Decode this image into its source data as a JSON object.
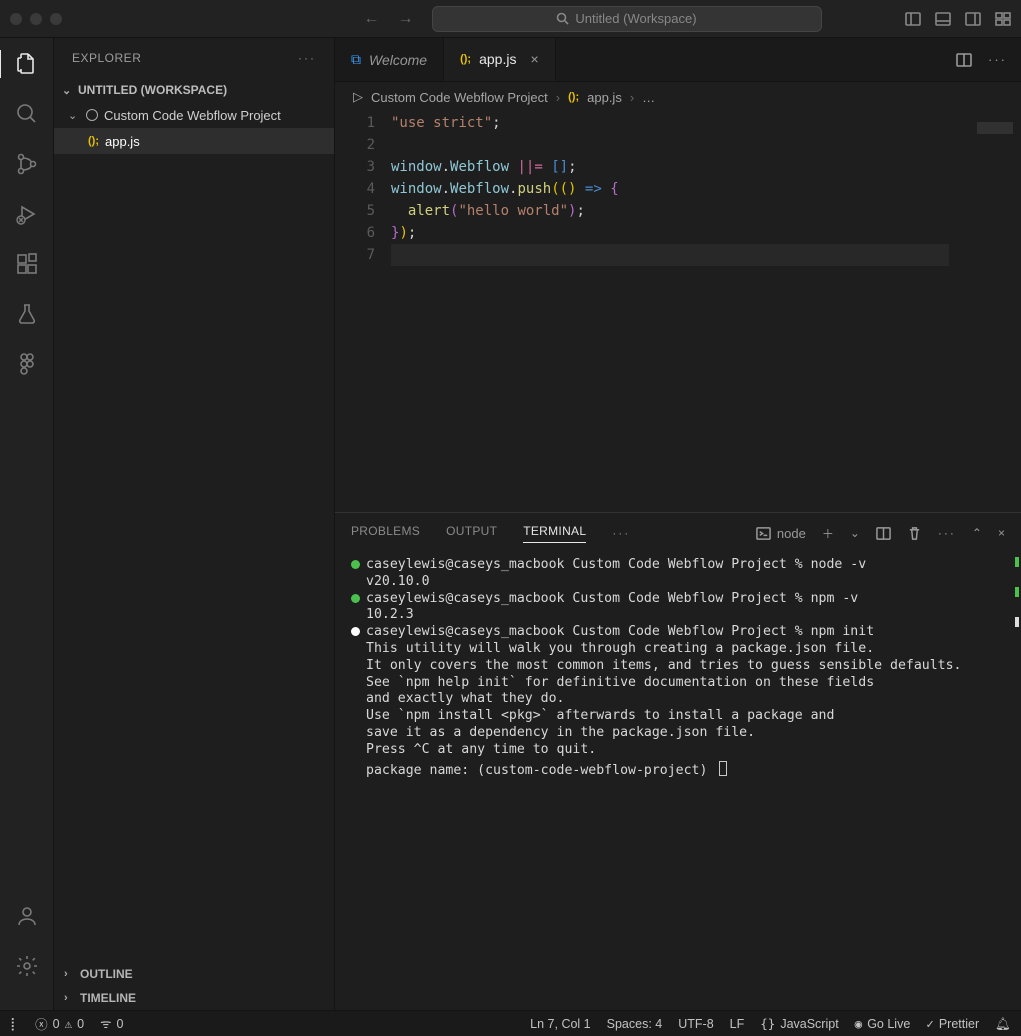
{
  "titlebar": {
    "title": "Untitled (Workspace)"
  },
  "sidebar": {
    "header": "EXPLORER",
    "workspace": "UNTITLED (WORKSPACE)",
    "project": "Custom Code Webflow Project",
    "file": "app.js",
    "file_prefix": "();",
    "outline": "OUTLINE",
    "timeline": "TIMELINE"
  },
  "tabs": {
    "welcome": "Welcome",
    "active": "app.js",
    "active_prefix": "();"
  },
  "breadcrumb": {
    "folder": "Custom Code Webflow Project",
    "file": "app.js",
    "file_prefix": "();",
    "more": "…"
  },
  "code": {
    "lines": [
      "1",
      "2",
      "3",
      "4",
      "5",
      "6",
      "7"
    ],
    "l1a": "\"use strict\"",
    "l1b": ";",
    "l3a": "window",
    "l3b": ".",
    "l3c": "Webflow",
    "l3d": " ",
    "l3e": "||=",
    "l3f": " ",
    "l3g": "[]",
    "l3h": ";",
    "l4a": "window",
    "l4b": ".",
    "l4c": "Webflow",
    "l4d": ".",
    "l4e": "push",
    "l4f": "((",
    "l4g": ")",
    "l4h": " => ",
    "l4i": "{",
    "l5a": "  ",
    "l5b": "alert",
    "l5c": "(",
    "l5d": "\"hello world\"",
    "l5e": ")",
    "l5f": ";",
    "l6a": "}",
    "l6b": ")",
    "l6c": ";"
  },
  "panel": {
    "tabs": {
      "problems": "PROBLEMS",
      "output": "OUTPUT",
      "terminal": "TERMINAL"
    },
    "term_name": "node"
  },
  "terminal": {
    "l1": "caseylewis@caseys_macbook Custom Code Webflow Project % node -v",
    "l2": "v20.10.0",
    "l3": "caseylewis@caseys_macbook Custom Code Webflow Project % npm -v",
    "l4": "10.2.3",
    "l5": "caseylewis@caseys_macbook Custom Code Webflow Project % npm init",
    "l6": "This utility will walk you through creating a package.json file.",
    "l7": "It only covers the most common items, and tries to guess sensible defaults.",
    "l8": "",
    "l9": "See `npm help init` for definitive documentation on these fields",
    "l10": "and exactly what they do.",
    "l11": "",
    "l12": "Use `npm install <pkg>` afterwards to install a package and",
    "l13": "save it as a dependency in the package.json file.",
    "l14": "",
    "l15": "Press ^C at any time to quit.",
    "l16": "package name: (custom-code-webflow-project) "
  },
  "status": {
    "errors": "0",
    "warnings": "0",
    "port": "0",
    "cursor": "Ln 7, Col 1",
    "spaces": "Spaces: 4",
    "encoding": "UTF-8",
    "eol": "LF",
    "lang": "JavaScript",
    "golive": "Go Live",
    "prettier": "Prettier"
  }
}
